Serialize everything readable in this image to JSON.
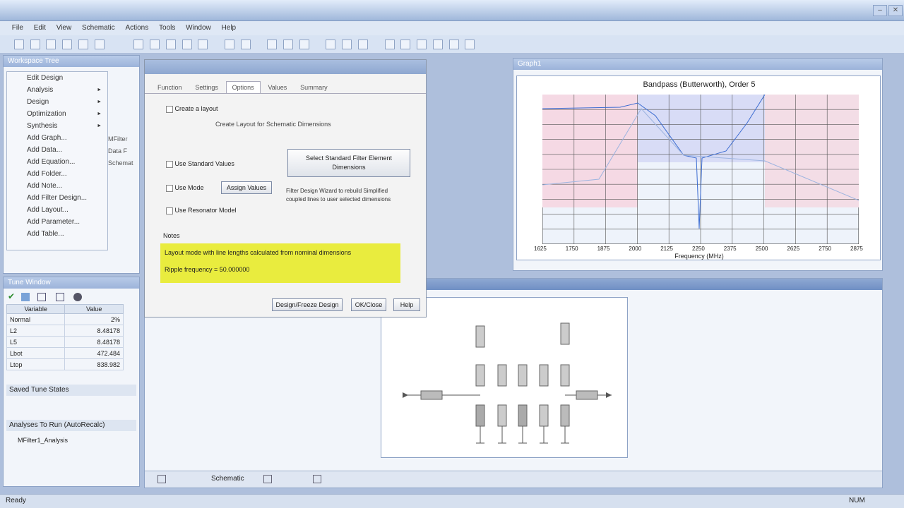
{
  "menu": [
    "File",
    "Edit",
    "View",
    "Schematic",
    "Actions",
    "Tools",
    "Window",
    "Help"
  ],
  "left_panel": {
    "title": "Workspace Tree",
    "context_menu": [
      {
        "label": "Edit Design",
        "submenu": false
      },
      {
        "label": "Analysis",
        "submenu": true
      },
      {
        "label": "Design",
        "submenu": true
      },
      {
        "label": "Optimization",
        "submenu": true
      },
      {
        "label": "Synthesis",
        "submenu": true
      },
      {
        "label": "Add Graph...",
        "submenu": false
      },
      {
        "label": "Add Data...",
        "submenu": false
      },
      {
        "label": "Add Equation...",
        "submenu": false
      },
      {
        "label": "Add Folder...",
        "submenu": false
      },
      {
        "label": "Add Note...",
        "submenu": false
      },
      {
        "label": "Add Filter Design...",
        "submenu": false
      },
      {
        "label": "Add Layout...",
        "submenu": false
      },
      {
        "label": "Add Parameter...",
        "submenu": false
      },
      {
        "label": "Add Table...",
        "submenu": false
      }
    ],
    "tree_fragments": [
      "MFilter",
      "Data F",
      "Schemat"
    ]
  },
  "tune_window": {
    "title": "Tune Window",
    "columns": [
      "Variable",
      "Value"
    ],
    "rows": [
      {
        "variable": "Normal",
        "value": "2%"
      },
      {
        "variable": "L2",
        "value": "8.48178"
      },
      {
        "variable": "L5",
        "value": "8.48178"
      },
      {
        "variable": "Lbot",
        "value": "472.484"
      },
      {
        "variable": "Ltop",
        "value": "838.982"
      }
    ],
    "saved_states_label": "Saved Tune States",
    "analyses_label": "Analyses To Run (AutoRecalc)",
    "analysis_item": "MFilter1_Analysis"
  },
  "dialog": {
    "tabs": [
      "Function",
      "Settings",
      "Options",
      "Values",
      "Summary"
    ],
    "active_tab": "Options",
    "opt1": "Create a layout",
    "opt1_note": "Create Layout for Schematic Dimensions",
    "opt2": "Use Standard Values",
    "opt3": "Use Mode",
    "opt3_btn": "Assign Values",
    "opt4": "Use Resonator Model",
    "right_btn": "Select Standard Filter Element Dimensions",
    "right_note": "Filter Design Wizard to rebuild Simplified coupled lines to user selected dimensions",
    "notes_label": "Notes",
    "notes_line1": "Layout mode with line lengths calculated from nominal dimensions",
    "notes_line2": "Ripple frequency = 50.000000",
    "btn_design": "Design/Freeze Design",
    "btn_ok": "OK/Close",
    "btn_help": "Help"
  },
  "graph": {
    "window_title": "Graph1",
    "chart_title": "Bandpass (Butterworth), Order 5",
    "xlabel": "Frequency (MHz)",
    "x_ticks": [
      "1625",
      "1750",
      "1875",
      "2000",
      "2125",
      "2250",
      "2375",
      "2500",
      "2625",
      "2750",
      "2875"
    ]
  },
  "schematic_window": {
    "bottom_tabs": [
      "Schematic"
    ]
  },
  "status": {
    "left": "Ready",
    "right": "NUM"
  }
}
